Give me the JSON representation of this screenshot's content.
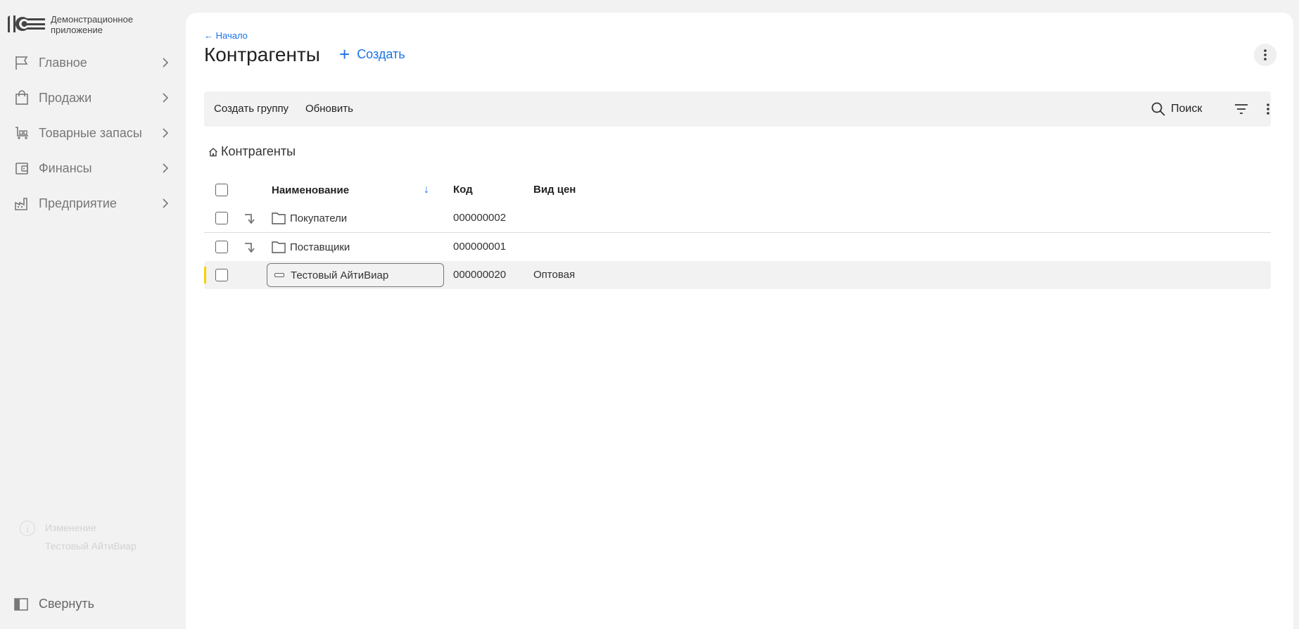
{
  "app": {
    "logo_line1": "Демонстрационное",
    "logo_line2": "приложение"
  },
  "sidebar": {
    "items": [
      {
        "label": "Главное",
        "icon": "flag-icon"
      },
      {
        "label": "Продажи",
        "icon": "shopping-bag-icon"
      },
      {
        "label": "Товарные запасы",
        "icon": "cart-icon"
      },
      {
        "label": "Финансы",
        "icon": "wallet-icon"
      },
      {
        "label": "Предприятие",
        "icon": "factory-icon"
      }
    ],
    "collapse_label": "Свернуть"
  },
  "notification": {
    "title": "Изменение",
    "subtitle": "Тестовый АйтиВиар"
  },
  "header": {
    "back_label": "← Начало",
    "title": "Контрагенты",
    "create_label": "Создать"
  },
  "toolbar": {
    "create_group_label": "Создать группу",
    "refresh_label": "Обновить",
    "search_label": "Поиск"
  },
  "group_path": {
    "label": "Контрагенты"
  },
  "table": {
    "columns": {
      "name": "Наименование",
      "code": "Код",
      "price_type": "Вид цен"
    },
    "rows": [
      {
        "type": "folder",
        "name": "Покупатели",
        "code": "000000002",
        "price_type": ""
      },
      {
        "type": "folder",
        "name": "Поставщики",
        "code": "000000001",
        "price_type": ""
      },
      {
        "type": "element",
        "name": "Тестовый АйтиВиар",
        "code": "000000020",
        "price_type": "Оптовая",
        "selected": true
      }
    ]
  },
  "colors": {
    "accent": "#1a73e8",
    "current_row_marker": "#f5d000"
  }
}
